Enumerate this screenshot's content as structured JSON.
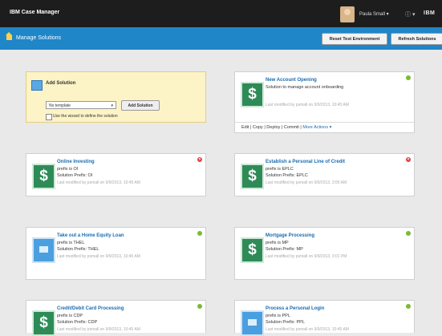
{
  "header": {
    "app_title": "IBM Case Manager",
    "user": "Paula Small ▾",
    "help": "ⓘ ▾",
    "brand": "IBM"
  },
  "subheader": {
    "crumb": "Manage Solutions",
    "reset_label": "Reset Test Environment",
    "refresh_label": "Refresh Solutions"
  },
  "add_solution": {
    "title": "Add Solution",
    "template_value": "No template",
    "add_label": "Add Solution",
    "wizard_label": "Use the wizard to define the solution"
  },
  "featured": {
    "title": "New Account Opening",
    "desc": "Solution to manage account onboarding",
    "modified": "Last modified by psmall on 9/9/2013, 10:45 AM",
    "actions": "Edit | Copy | Deploy | Commit |",
    "more": "More Actions ▾"
  },
  "solutions": [
    {
      "title": "Online Investing",
      "l1": "prefix is OI",
      "l2": "Solution Prefix: OI",
      "modified": "Last modified by psmall on 9/9/2013, 10:45 AM",
      "status": "error"
    },
    {
      "title": "Establish a Personal Line of Credit",
      "l1": "prefix is EPLC",
      "l2": "Solution Prefix: EPLC",
      "modified": "Last modified by psmall on 9/9/2013, 3:55 AM",
      "status": "error"
    },
    {
      "title": "Take out a Home Equity Loan",
      "l1": "prefix is THEL",
      "l2": "Solution Prefix: THEL",
      "modified": "Last modified by psmall on 9/9/2013, 10:45 AM",
      "status": "ok"
    },
    {
      "title": "Mortgage Processing",
      "l1": "prefix is MP",
      "l2": "Solution Prefix: MP",
      "modified": "Last modified by psmall on 9/9/2013, 3:01 PM",
      "status": "ok"
    },
    {
      "title": "Credit/Debit Card Processing",
      "l1": "prefix is CDP",
      "l2": "Solution Prefix: CDP",
      "modified": "Last modified by psmall on 9/9/2013, 10:45 AM",
      "status": "ok"
    },
    {
      "title": "Process a Personal Login",
      "l1": "prefix is PPL",
      "l2": "Solution Prefix: PPL",
      "modified": "Last modified by psmall on 9/9/2013, 10:45 AM",
      "status": "ok"
    }
  ],
  "icons": {
    "status_ok": "green-dot",
    "status_error": "red-x"
  },
  "colors": {
    "top_bar": "#1d1d1d",
    "blue_bar": "#1f86c8",
    "link": "#1a6cb0",
    "ok": "#7bbb33",
    "error": "#e04040",
    "dollar": "#2e8b57"
  }
}
